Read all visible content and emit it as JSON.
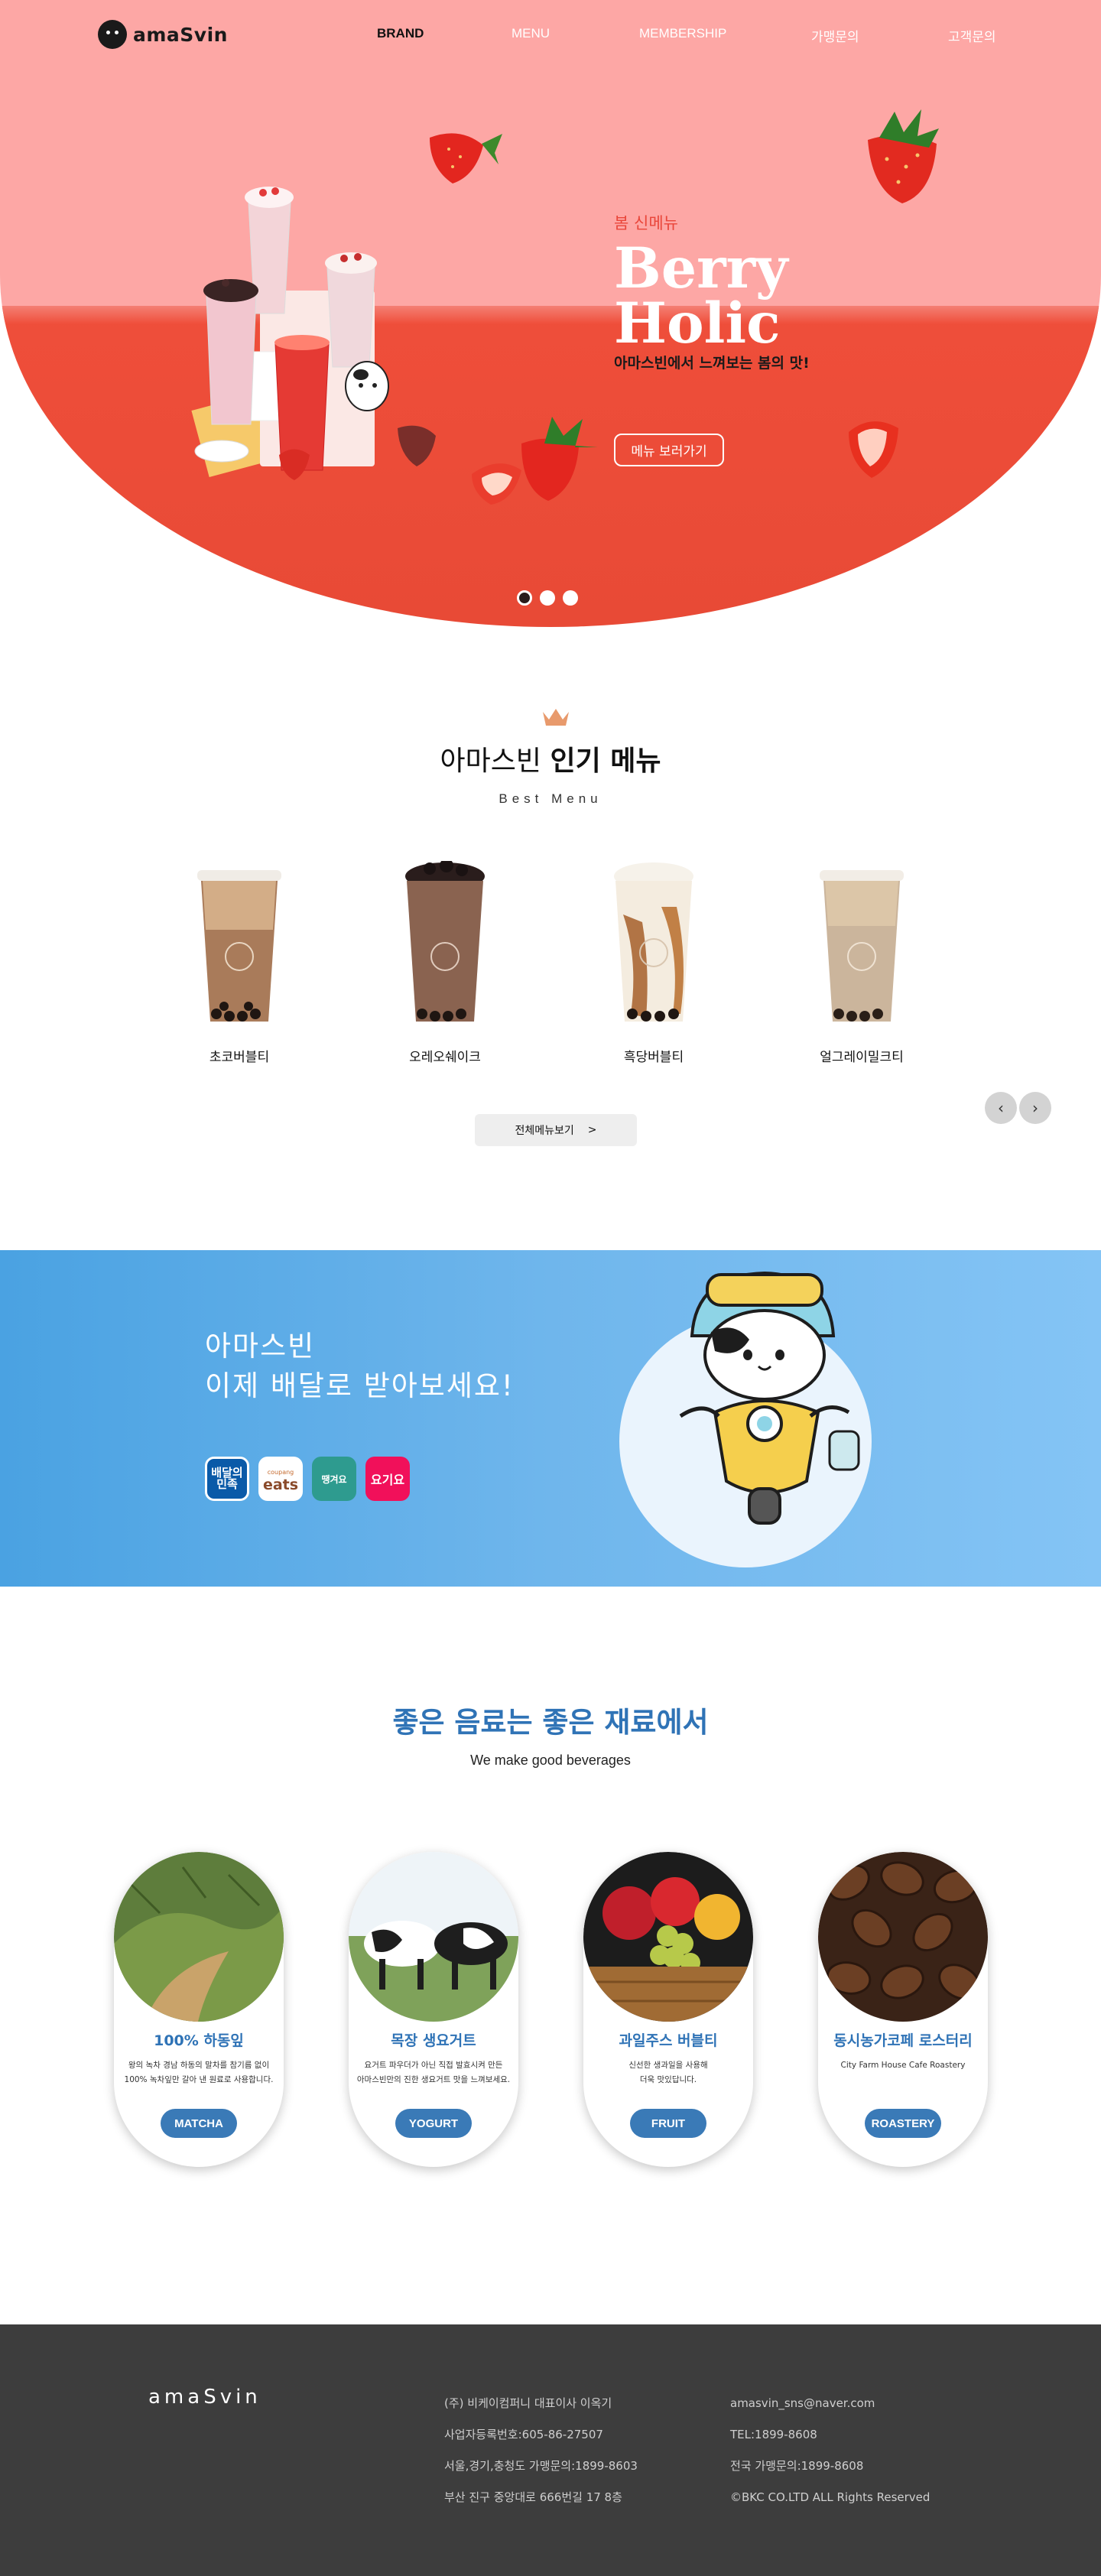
{
  "nav": {
    "logo": "amaSvin",
    "items": [
      "BRAND",
      "MENU",
      "MEMBERSHIP",
      "가맹문의",
      "고객문의"
    ]
  },
  "hero": {
    "tag": "봄 신메뉴",
    "title_line1": "Berry",
    "title_line2": "Holic",
    "subtitle": "아마스빈에서 느껴보는 봄의 맛!",
    "button": "메뉴 보러가기",
    "slides": 3,
    "active_slide": 1
  },
  "best": {
    "title_light": "아마스빈",
    "title_bold": "인기 메뉴",
    "subtitle": "Best Menu",
    "items": [
      "초코버블티",
      "오레오쉐이크",
      "흑당버블티",
      "얼그레이밀크티"
    ],
    "all_button": "전체메뉴보기",
    "all_button_arrow": ">",
    "prev": "‹",
    "next": "›"
  },
  "delivery": {
    "line1": "아마스빈",
    "line2": "이제 배달로 받아보세요!",
    "apps": {
      "baemin": "배달의민족",
      "coupang": "eats",
      "coupang_small": "coupang",
      "ddangyo": "땡겨요",
      "yogiyo": "요기요"
    }
  },
  "ingredients": {
    "title": "좋은 음료는 좋은 재료에서",
    "subtitle": "We make good beverages",
    "cards": [
      {
        "name": "100% 하동잎",
        "desc1": "왕의 녹차 경남 하동의 말차를 참기름 없이",
        "desc2": "100% 녹차잎만 갈아 낸 원료로 사용합니다.",
        "button": "MATCHA"
      },
      {
        "name": "목장 생요거트",
        "desc1": "요거트 파우더가 아닌 직접 발효시켜 만든",
        "desc2": "아마스빈만의 진한 생요거트 맛을 느껴보세요.",
        "button": "YOGURT"
      },
      {
        "name": "과일주스 버블티",
        "desc1": "신선한 생과일을 사용해",
        "desc2": "더욱 맛있답니다.",
        "button": "FRUIT"
      },
      {
        "name": "동시농가코페 로스터리",
        "desc1": "City Farm House Cafe Roastery",
        "desc2": "",
        "button": "ROASTERY"
      }
    ]
  },
  "footer": {
    "logo": "amaSvin",
    "col1": [
      "(주) 비케이컴퍼니 대표이사 이옥기",
      "사업자등록번호:605-86-27507",
      "서울,경기,충청도 가맹문의:1899-8603",
      "부산 진구 중앙대로 666번길 17 8층"
    ],
    "col2": [
      "amasvin_sns@naver.com",
      "TEL:1899-8608",
      "전국 가맹문의:1899-8608",
      "©BKC CO.LTD ALL Rights Reserved"
    ]
  },
  "colors": {
    "hero_pink": "#fda7a5",
    "hero_red": "#e84a36",
    "accent_blue": "#2f73b6",
    "delivery_blue": "#4aa2e2",
    "footer": "#3d3d3d"
  }
}
